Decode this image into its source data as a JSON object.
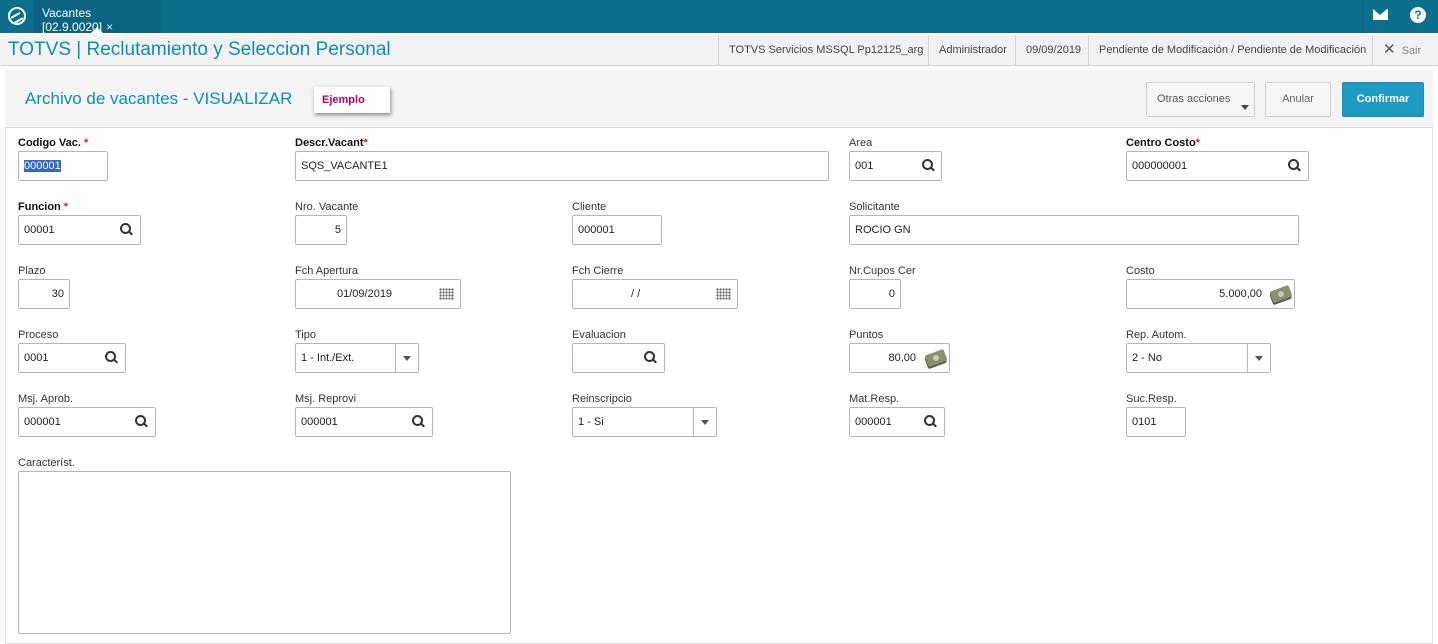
{
  "topbar": {
    "tab_label": "Vacantes [02.9.0020]",
    "tab_close": "×",
    "help_glyph": "?"
  },
  "appbar": {
    "title": "TOTVS | Reclutamiento y Seleccion Personal",
    "environment": "TOTVS Servicios MSSQL Pp12125_arg",
    "user": "Administrador",
    "date": "09/09/2019",
    "status": "Pendiente de Modificación / Pendiente de Modificación",
    "exit_label": "Sair",
    "exit_glyph": "✕"
  },
  "page": {
    "title": "Archivo de vacantes - VISUALIZAR",
    "example_tag": "Ejemplo",
    "other_actions": "Otras acciones",
    "cancel": "Anular",
    "confirm": "Confirmar"
  },
  "form": {
    "codigo_vac": {
      "label": "Codigo Vac.",
      "value": "000001",
      "required": "*"
    },
    "descr_vacant": {
      "label": "Descr.Vacant",
      "value": "SQS_VACANTE1",
      "required": "*"
    },
    "area": {
      "label": "Area",
      "value": "001"
    },
    "centro_costo": {
      "label": "Centro Costo",
      "value": "000000001",
      "required": "*"
    },
    "funcion": {
      "label": "Funcion",
      "value": "00001",
      "required": "*"
    },
    "nro_vacante": {
      "label": "Nro. Vacante",
      "value": "5"
    },
    "cliente": {
      "label": "Cliente",
      "value": "000001"
    },
    "solicitante": {
      "label": "Solicitante",
      "value": "ROCIO GN"
    },
    "plazo": {
      "label": "Plazo",
      "value": "30"
    },
    "fch_apertura": {
      "label": "Fch Apertura",
      "value": "01/09/2019"
    },
    "fch_cierre": {
      "label": "Fch Cierre",
      "value": "/  /"
    },
    "nr_cupos_cer": {
      "label": "Nr.Cupos Cer",
      "value": "0"
    },
    "costo": {
      "label": "Costo",
      "value": "5.000,00"
    },
    "proceso": {
      "label": "Proceso",
      "value": "0001"
    },
    "tipo": {
      "label": "Tipo",
      "value": "1 - Int./Ext."
    },
    "evaluacion": {
      "label": "Evaluacion",
      "value": ""
    },
    "puntos": {
      "label": "Puntos",
      "value": "80,00"
    },
    "rep_autom": {
      "label": "Rep. Autom.",
      "value": "2 - No"
    },
    "msj_aprob": {
      "label": "Msj. Aprob.",
      "value": "000001"
    },
    "msj_reprovi": {
      "label": "Msj. Reprovi",
      "value": "000001"
    },
    "reinscripcio": {
      "label": "Reinscripcio",
      "value": "1 - Si"
    },
    "mat_resp": {
      "label": "Mat.Resp.",
      "value": "000001"
    },
    "suc_resp": {
      "label": "Suc.Resp.",
      "value": "0101"
    },
    "caracterist": {
      "label": "Característ.",
      "value": ""
    }
  }
}
